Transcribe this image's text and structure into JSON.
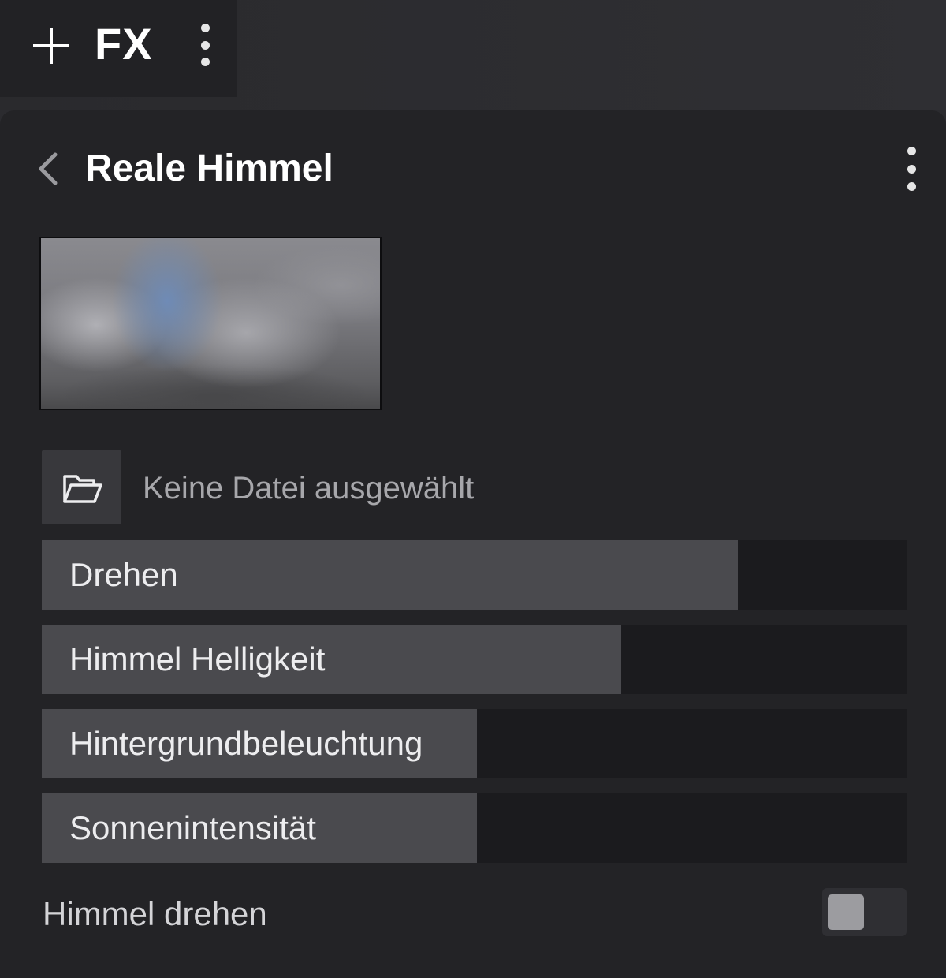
{
  "top_bar": {
    "fx_label": "FX",
    "add_icon": "plus-icon",
    "menu_icon": "kebab-menu-icon"
  },
  "panel": {
    "title": "Reale Himmel",
    "back_icon": "chevron-left-icon",
    "menu_icon": "kebab-menu-icon",
    "preview_image": "cloudy-sky-panorama",
    "file_picker": {
      "icon": "folder-open-icon",
      "status": "Keine Datei ausgewählt"
    },
    "sliders": [
      {
        "label": "Drehen",
        "fill_fraction": 0.805
      },
      {
        "label": "Himmel Helligkeit",
        "fill_fraction": 0.67
      },
      {
        "label": "Hintergrundbeleuchtung",
        "fill_fraction": 0.503
      },
      {
        "label": "Sonnenintensität",
        "fill_fraction": 0.503
      }
    ],
    "toggle": {
      "label": "Himmel drehen",
      "checked": false
    }
  },
  "colors": {
    "background": "#232326",
    "slider_fill": "#4a4a4e",
    "slider_track": "#1b1b1e",
    "text": "#ededef"
  }
}
